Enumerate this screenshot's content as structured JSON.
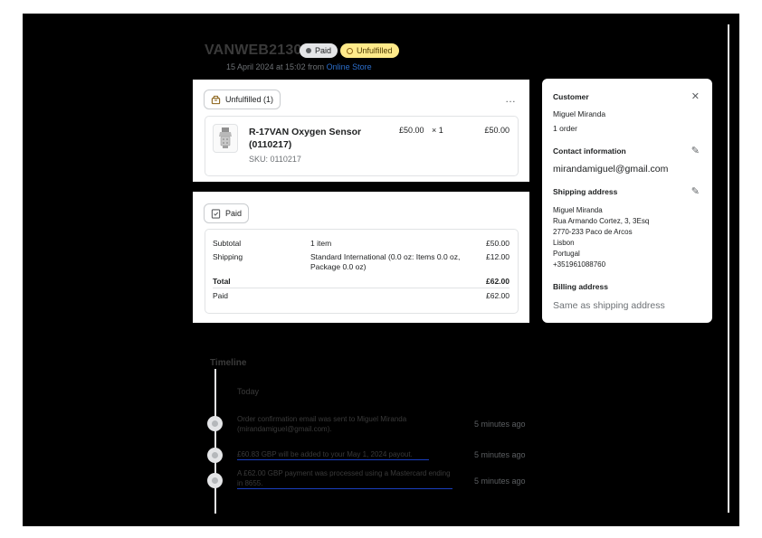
{
  "order": {
    "id": "VANWEB2130",
    "paid_badge": "Paid",
    "fulfillment_badge": "Unfulfilled",
    "date_text": "15 April 2024 at 15:02 from",
    "channel": "Online Store"
  },
  "fulfillment": {
    "chip_label": "Unfulfilled (1)",
    "more_icon": "…",
    "item": {
      "name": "R-17VAN Oxygen Sensor (0110217)",
      "sku": "SKU: 0110217",
      "unit_price": "£50.00",
      "quantity": "× 1",
      "line_total": "£50.00"
    }
  },
  "payment": {
    "chip_label": "Paid",
    "rows": [
      {
        "label": "Subtotal",
        "detail": "1 item",
        "amount": "£50.00"
      },
      {
        "label": "Shipping",
        "detail": "Standard International (0.0 oz: Items 0.0 oz, Package 0.0 oz)",
        "amount": "£12.00"
      },
      {
        "label": "Total",
        "detail": "",
        "amount": "£62.00"
      },
      {
        "label": "Paid",
        "detail": "",
        "amount": "£62.00"
      }
    ]
  },
  "customer": {
    "heading": "Customer",
    "name": "Miguel Miranda",
    "orders": "1 order",
    "contact_heading": "Contact information",
    "email": "mirandamiguel@gmail.com",
    "shipping_heading": "Shipping address",
    "address_lines": [
      "Miguel Miranda",
      "Rua Armando Cortez, 3, 3Esq",
      "2770-233 Paco de Arcos",
      "Lisbon",
      "Portugal",
      "+351961088760"
    ],
    "billing_heading": "Billing address",
    "billing_text": "Same as shipping address"
  },
  "timeline": {
    "title": "Timeline",
    "day": "Today",
    "events": [
      {
        "text": "Order confirmation email was sent to Miguel Miranda (mirandamiguel@gmail.com).",
        "time": "5 minutes ago"
      },
      {
        "text": "£60.83 GBP will be added to your May 1, 2024 payout.",
        "time": "5 minutes ago"
      },
      {
        "text": "A £62.00 GBP payment was processed using a Mastercard ending in 8655.",
        "time": "5 minutes ago"
      }
    ]
  },
  "colors": {
    "accent_link": "#2c6ecb",
    "unfulfilled_badge": "#ffea8a",
    "paid_badge": "#e4e5e7"
  }
}
